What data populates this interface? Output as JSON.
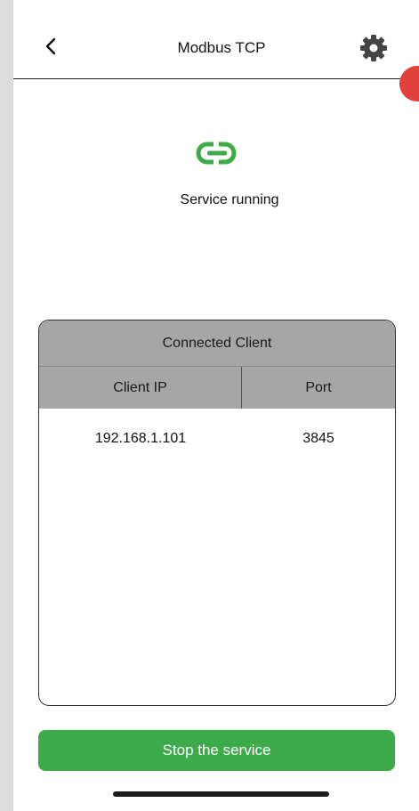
{
  "header": {
    "title": "Modbus TCP",
    "back_icon": "chevron-left-icon",
    "settings_icon": "gear-icon"
  },
  "status": {
    "icon": "link-icon",
    "text": "Service running",
    "color": "#3dab4a"
  },
  "clients_table": {
    "title": "Connected Client",
    "columns": [
      "Client IP",
      "Port"
    ],
    "rows": [
      {
        "ip": "192.168.1.101",
        "port": "3845"
      }
    ]
  },
  "actions": {
    "stop_label": "Stop the service"
  },
  "colors": {
    "accent": "#3dab4a",
    "header_fill": "#a6a6a6",
    "notification_dot": "#e0413b"
  }
}
